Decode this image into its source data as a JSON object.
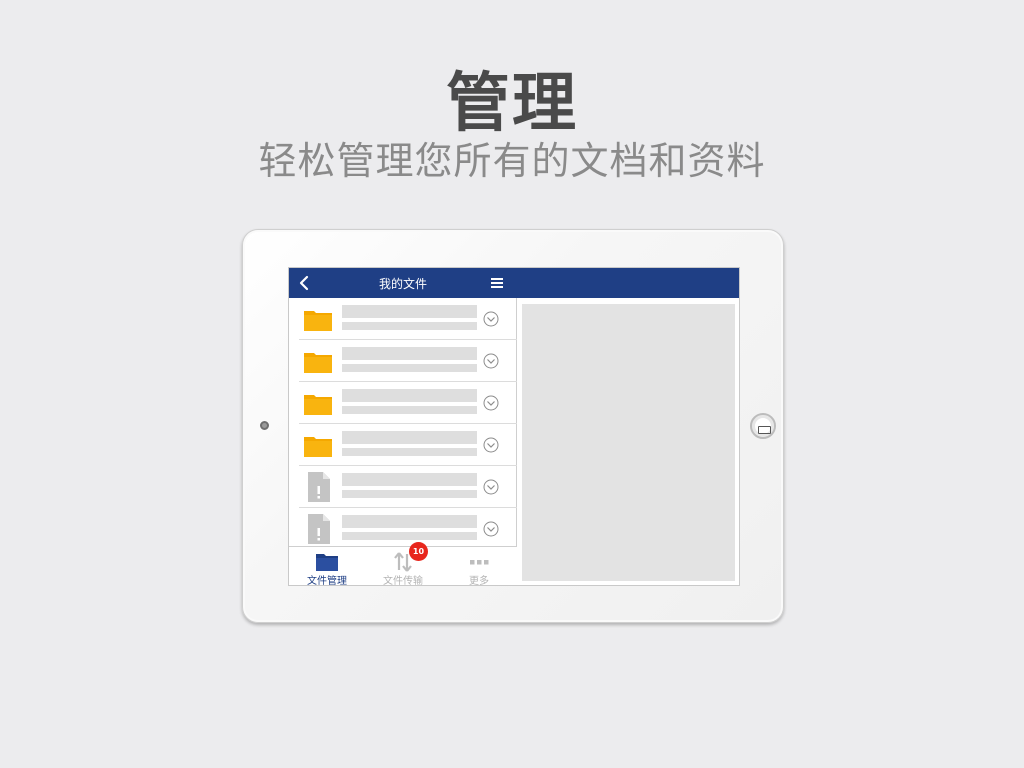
{
  "headline": "管理",
  "subheadline": "轻松管理您所有的文档和资料",
  "app": {
    "header": {
      "title": "我的文件",
      "back_icon": "chevron-left-icon",
      "menu_icon": "menu-icon"
    },
    "file_list": [
      {
        "type": "folder",
        "icon": "folder-icon",
        "action_icon": "chevron-down-circle-icon"
      },
      {
        "type": "folder",
        "icon": "folder-icon",
        "action_icon": "chevron-down-circle-icon"
      },
      {
        "type": "folder",
        "icon": "folder-icon",
        "action_icon": "chevron-down-circle-icon"
      },
      {
        "type": "folder",
        "icon": "folder-icon",
        "action_icon": "chevron-down-circle-icon"
      },
      {
        "type": "unknown-file",
        "icon": "unknown-file-icon",
        "action_icon": "chevron-down-circle-icon"
      },
      {
        "type": "unknown-file",
        "icon": "unknown-file-icon",
        "action_icon": "chevron-down-circle-icon"
      }
    ],
    "tabs": [
      {
        "label": "文件管理",
        "icon": "folder-icon",
        "active": true
      },
      {
        "label": "文件传输",
        "icon": "transfer-icon",
        "badge": "10",
        "active": false
      },
      {
        "label": "更多",
        "icon": "more-icon",
        "active": false
      }
    ]
  },
  "colors": {
    "brand": "#1f3f85",
    "folder": "#f5a800",
    "badge": "#e8261c",
    "background": "#ececee"
  }
}
